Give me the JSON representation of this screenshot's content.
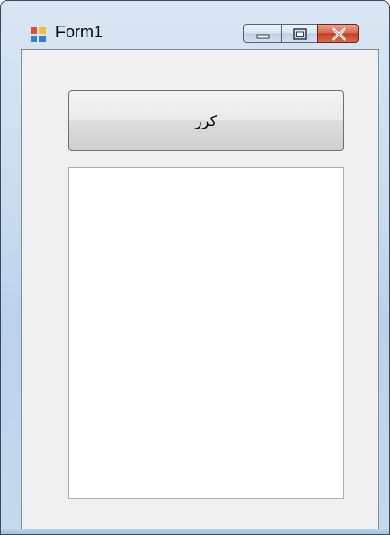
{
  "window": {
    "title": "Form1",
    "icon": "winforms-app-icon",
    "controls": [
      "minimize-icon",
      "maximize-icon",
      "close-icon"
    ]
  },
  "form": {
    "button_label": "کرر",
    "listbox_items": []
  },
  "colors": {
    "client_bg": "#f0f0f0",
    "close_button": "#c43c1c",
    "listbox_bg": "#ffffff"
  }
}
